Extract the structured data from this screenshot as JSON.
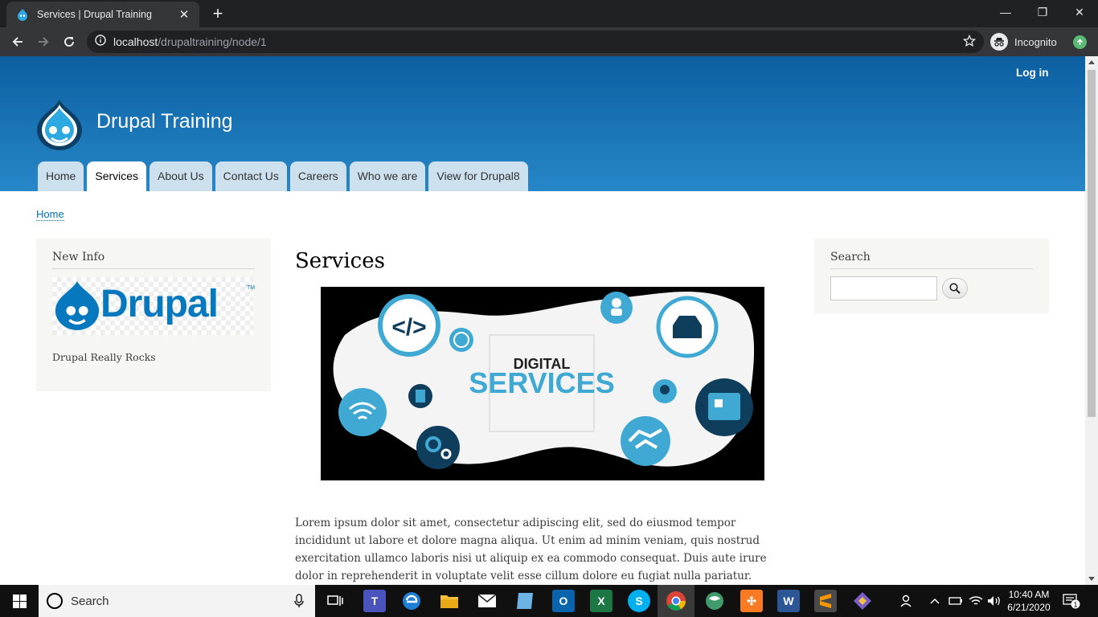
{
  "browser": {
    "tab_title": "Services | Drupal Training",
    "url_host": "localhost",
    "url_path": "/drupaltraining/node/1",
    "profile_label": "Incognito"
  },
  "site": {
    "login_label": "Log in",
    "site_name": "Drupal Training",
    "menu": [
      {
        "label": "Home",
        "active": false
      },
      {
        "label": "Services",
        "active": true
      },
      {
        "label": "About Us",
        "active": false
      },
      {
        "label": "Contact Us",
        "active": false
      },
      {
        "label": "Careers",
        "active": false
      },
      {
        "label": "Who we are",
        "active": false
      },
      {
        "label": "View for Drupal8",
        "active": false
      }
    ],
    "breadcrumb": "Home"
  },
  "sidebar_first": {
    "title": "New Info",
    "logo_text": "Drupal",
    "logo_tm": "TM",
    "text": "Drupal Really Rocks"
  },
  "sidebar_second": {
    "title": "Search"
  },
  "content": {
    "title": "Services",
    "hero_line1": "DIGITAL",
    "hero_line2": "SERVICES",
    "body": "Lorem ipsum dolor sit amet, consectetur adipiscing elit, sed do eiusmod tempor incididunt ut labore et dolore magna aliqua. Ut enim ad minim veniam, quis nostrud exercitation ullamco laboris nisi ut aliquip ex ea commodo consequat. Duis aute irure dolor in reprehenderit in voluptate velit esse cillum dolore eu fugiat nulla pariatur. Excepteur sint"
  },
  "taskbar": {
    "search_label": "Search",
    "time": "10:40 AM",
    "date": "6/21/2020",
    "notification_count": "1"
  },
  "colors": {
    "header_top": "#0b5fa0",
    "header_bottom": "#2787c8",
    "link": "#0071b3",
    "menu_tab": "#cde0ed"
  }
}
